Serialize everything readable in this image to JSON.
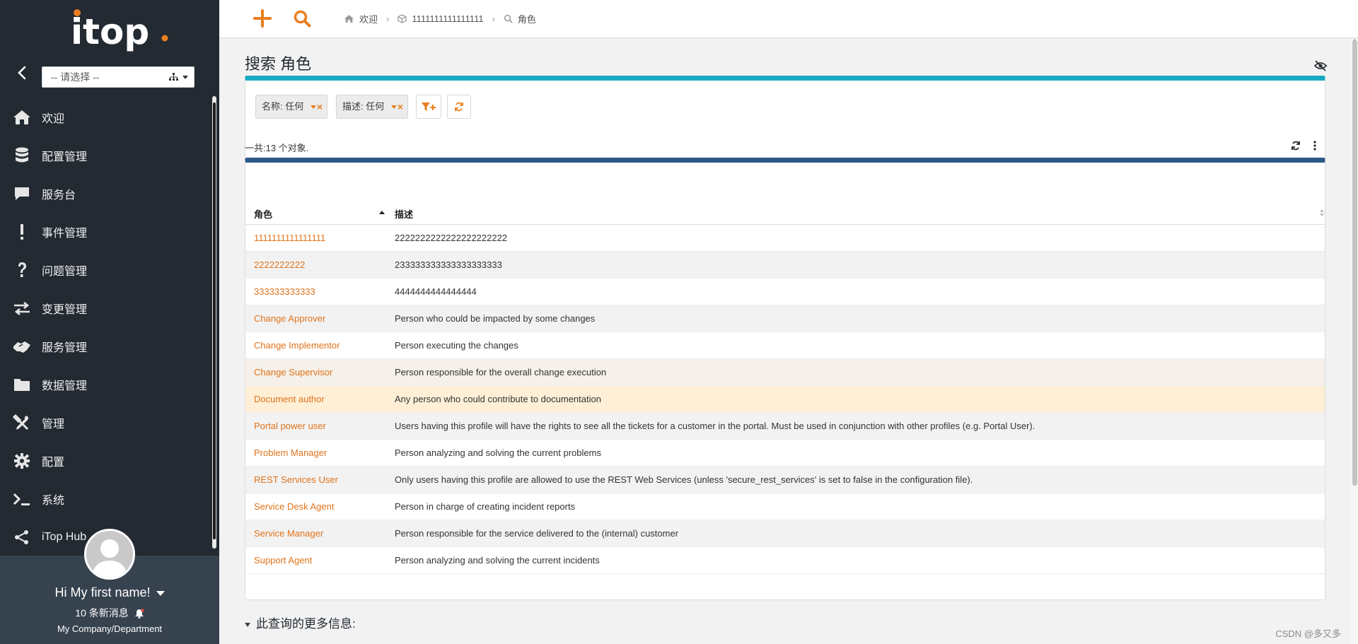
{
  "sidebar": {
    "org_select": {
      "value": "-- 请选择 --"
    },
    "menu": [
      {
        "label": "欢迎",
        "icon": "home-icon"
      },
      {
        "label": "配置管理",
        "icon": "database-icon"
      },
      {
        "label": "服务台",
        "icon": "speech-bubble-icon"
      },
      {
        "label": "事件管理",
        "icon": "exclamation-icon"
      },
      {
        "label": "问题管理",
        "icon": "question-icon"
      },
      {
        "label": "变更管理",
        "icon": "exchange-arrows-icon"
      },
      {
        "label": "服务管理",
        "icon": "handshake-icon"
      },
      {
        "label": "数据管理",
        "icon": "folder-icon"
      },
      {
        "label": "管理",
        "icon": "tools-icon"
      },
      {
        "label": "配置",
        "icon": "gear-icon"
      },
      {
        "label": "系统",
        "icon": "terminal-icon"
      },
      {
        "label": "iTop Hub",
        "icon": "share-icon"
      }
    ],
    "user": {
      "greeting": "Hi My first name!",
      "messages": "10 条新消息",
      "organization": "My Company/Department"
    }
  },
  "topbar": {
    "breadcrumb": [
      "欢迎",
      "1111111111111111",
      "角色"
    ]
  },
  "main": {
    "title": "搜索 角色",
    "criteria": [
      {
        "label": "名称: 任何"
      },
      {
        "label": "描述: 任何"
      }
    ],
    "total": "一共:13 个对象.",
    "table": {
      "columns": [
        "角色",
        "描述"
      ],
      "rows": [
        {
          "role": "1111111111111111",
          "description": "2222222222222222222222"
        },
        {
          "role": "2222222222",
          "description": "233333333333333333333"
        },
        {
          "role": "333333333333",
          "description": "4444444444444444"
        },
        {
          "role": "Change Approver",
          "description": "Person who could be impacted by some changes"
        },
        {
          "role": "Change Implementor",
          "description": "Person executing the changes"
        },
        {
          "role": "Change Supervisor",
          "description": "Person responsible for the overall change execution"
        },
        {
          "role": "Document author",
          "description": "Any person who could contribute to documentation"
        },
        {
          "role": "Portal power user",
          "description": "Users having this profile will have the rights to see all the tickets for a customer in the portal. Must be used in conjunction with other profiles (e.g. Portal User)."
        },
        {
          "role": "Problem Manager",
          "description": "Person analyzing and solving the current problems"
        },
        {
          "role": "REST Services User",
          "description": "Only users having this profile are allowed to use the REST Web Services (unless 'secure_rest_services' is set to false in the configuration file)."
        },
        {
          "role": "Service Desk Agent",
          "description": "Person in charge of creating incident reports"
        },
        {
          "role": "Service Manager",
          "description": "Person responsible for the service delivered to the (internal) customer"
        },
        {
          "role": "Support Agent",
          "description": "Person analyzing and solving the current incidents"
        }
      ],
      "row_backgrounds": [
        "#ffffff",
        "#f2f2f2",
        "#ffffff",
        "#f2f2f2",
        "#ffffff",
        "#f5f0e9",
        "#ffefd6",
        "#f2f2f2",
        "#ffffff",
        "#f2f2f2",
        "#ffffff",
        "#f2f2f2",
        "#ffffff"
      ]
    },
    "more_info": "此查询的更多信息:"
  },
  "watermark": "CSDN @多又多",
  "colors": {
    "accent": "#ea7d1e",
    "link": "#e0731b",
    "sidebar_bg": "#232a32",
    "criteria_bar": "#19aac1",
    "list_bar": "#2d5887"
  }
}
